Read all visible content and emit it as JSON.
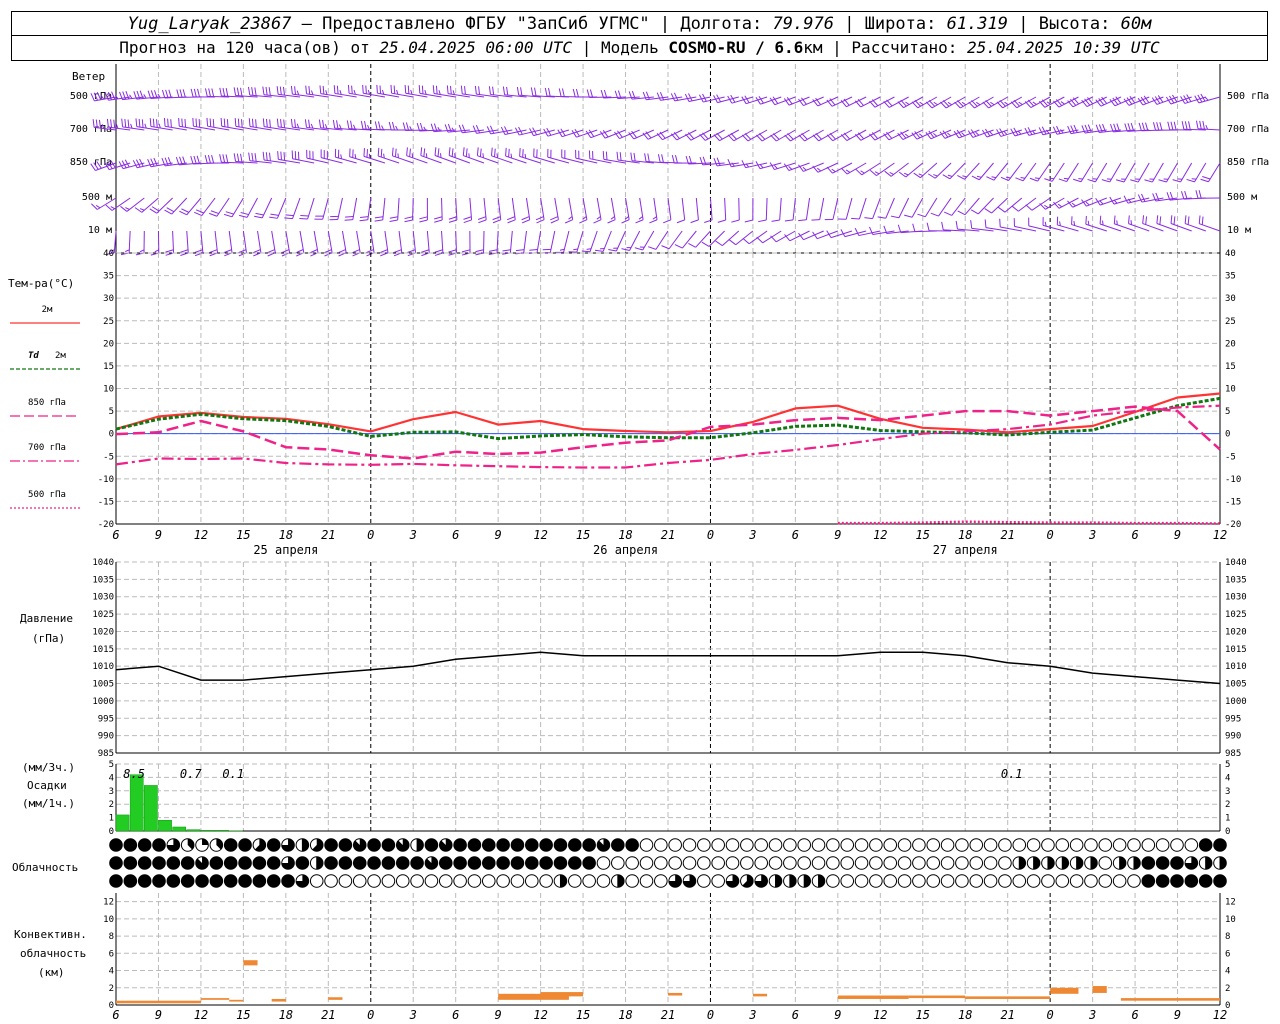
{
  "header": {
    "station": "Yug_Laryak_23867",
    "provider": "— Предоставлено ФГБУ \"ЗапСиб УГМС\"",
    "lon_label": "| Долгота:",
    "lon": "79.976",
    "lat_label": "| Широта:",
    "lat": "61.319",
    "alt_label": "| Высота:",
    "alt": "60м",
    "forecast_label": "Прогноз на 120 часа(ов) от",
    "forecast_time": "25.04.2025 06:00 UTC",
    "model_label": "| Модель",
    "model": "COSMO-RU / 6.6",
    "model_unit": "км",
    "calc_label": "| Рассчитано:",
    "calc_time": "25.04.2025 10:39 UTC"
  },
  "labels": {
    "wind": "Ветер",
    "wind_levels": [
      "500 гПа",
      "700 гПа",
      "850 гПа",
      "500 м",
      "10 м"
    ],
    "temp": "Тем-ра(°C)",
    "t2m": "2м",
    "td_sym": "Td",
    "td2m": "2м",
    "t850": "850 гПа",
    "t700": "700 гПа",
    "t500": "500 гПа",
    "pressure": "Давление",
    "pressure_unit": "(гПа)",
    "precip_unit3": "(мм/3ч.)",
    "precip": "Осадки",
    "precip_unit1": "(мм/1ч.)",
    "cloud": "Облачность",
    "conv1": "Конвективн.",
    "conv2": "облачность",
    "conv3": "(км)"
  },
  "time_axis": {
    "hour_labels": [
      "6",
      "9",
      "12",
      "15",
      "18",
      "21",
      "0",
      "3",
      "6",
      "9",
      "12",
      "15",
      "18",
      "21",
      "0",
      "3",
      "6",
      "9",
      "12",
      "15",
      "18",
      "21",
      "0",
      "3",
      "6",
      "9",
      "12"
    ],
    "day_labels": [
      "25 апреля",
      "26 апреля",
      "27 апреля"
    ]
  },
  "colors": {
    "t2m": "#ff3333",
    "td2m": "#117711",
    "t850": "#ee2288",
    "wind": "#8a2be2",
    "precip": "#22cc22",
    "conv": "#ee8833"
  },
  "chart_data": {
    "type": "line",
    "hours": [
      0,
      3,
      6,
      9,
      12,
      15,
      18,
      21,
      24,
      27,
      30,
      33,
      36,
      39,
      42,
      45,
      48,
      51,
      54,
      57,
      60,
      63,
      66,
      69,
      72,
      75,
      78
    ],
    "temperature": {
      "ylim": [
        -20,
        40
      ],
      "ticks": [
        -20,
        -15,
        -10,
        -5,
        0,
        5,
        10,
        15,
        20,
        25,
        30,
        35,
        40
      ],
      "series": [
        {
          "name": "2м",
          "values": [
            1,
            3.8,
            4.6,
            3.7,
            3.3,
            2.1,
            0.5,
            3.2,
            4.8,
            2.0,
            2.8,
            1.0,
            0.6,
            0.3,
            0.6,
            2.6,
            5.6,
            6.2,
            3.3,
            1.3,
            0.9,
            0.3,
            1.0,
            1.7,
            4.8,
            8.0,
            8.9
          ]
        },
        {
          "name": "Td 2м",
          "values": [
            1,
            3.2,
            4.3,
            3.3,
            2.9,
            1.6,
            -0.6,
            0.3,
            0.4,
            -1.1,
            -0.5,
            -0.2,
            -0.7,
            -0.9,
            -0.9,
            0.2,
            1.6,
            1.9,
            0.7,
            0.4,
            0.2,
            -0.3,
            0.3,
            0.8,
            3.5,
            6.2,
            7.8
          ]
        },
        {
          "name": "850 гПа",
          "values": [
            -0.1,
            0.3,
            2.8,
            0.5,
            -3,
            -3.5,
            -4.8,
            -5.5,
            -4,
            -4.5,
            -4.2,
            -3,
            -2,
            -1.5,
            1.5,
            2,
            3,
            3.5,
            3,
            4,
            5,
            5,
            4,
            5,
            6,
            5,
            -3.5
          ]
        },
        {
          "name": "700 гПа",
          "values": [
            -6.8,
            -5.5,
            -5.6,
            -5.5,
            -6.5,
            -6.8,
            -6.9,
            -6.7,
            -7,
            -7.2,
            -7.4,
            -7.5,
            -7.5,
            -6.5,
            -5.8,
            -4.5,
            -3.6,
            -2.5,
            -1.2,
            0,
            0.5,
            1,
            2,
            4,
            5,
            5.8,
            6.2
          ]
        },
        {
          "name": "500 гПа",
          "values": [
            null,
            null,
            null,
            null,
            null,
            null,
            null,
            null,
            null,
            null,
            null,
            null,
            null,
            null,
            null,
            null,
            null,
            -19.8,
            -19.8,
            -19.7,
            -19.5,
            -19.6,
            -19.7,
            -19.7,
            -19.8,
            -19.8,
            -19.9
          ]
        }
      ]
    },
    "pressure": {
      "ylim": [
        985,
        1040
      ],
      "ticks": [
        985,
        990,
        995,
        1000,
        1005,
        1010,
        1015,
        1020,
        1025,
        1030,
        1035,
        1040
      ],
      "values": [
        1009,
        1010,
        1006,
        1006,
        1007,
        1008,
        1009,
        1010,
        1012,
        1013,
        1014,
        1013,
        1013,
        1013,
        1013,
        1013,
        1013,
        1013,
        1014,
        1014,
        1013,
        1011,
        1010,
        1008,
        1007,
        1006,
        1005
      ]
    },
    "precipitation": {
      "ylim": [
        0,
        5
      ],
      "ticks": [
        0,
        1,
        2,
        3,
        4,
        5
      ],
      "hourly": [
        1.2,
        4.2,
        3.4,
        0.8,
        0.3,
        0.1,
        0.05,
        0.05,
        0.02
      ],
      "label_start_index": 0,
      "accum_labels": [
        {
          "hour": 1,
          "text": "8.5"
        },
        {
          "hour": 5,
          "text": "0.7"
        },
        {
          "hour": 8,
          "text": "0.1"
        },
        {
          "hour": 63,
          "text": "0.1"
        }
      ]
    },
    "convective": {
      "ylim": [
        0,
        13
      ],
      "ticks": [
        0,
        2,
        4,
        6,
        8,
        10,
        12
      ],
      "bars": [
        {
          "h0": 0,
          "h1": 6,
          "bot": 0.2,
          "top": 0.5
        },
        {
          "h0": 6,
          "h1": 8,
          "bot": 0.6,
          "top": 0.8
        },
        {
          "h0": 8,
          "h1": 9,
          "bot": 0.4,
          "top": 0.6
        },
        {
          "h0": 9,
          "h1": 10,
          "bot": 4.6,
          "top": 5.2
        },
        {
          "h0": 11,
          "h1": 12,
          "bot": 0.4,
          "top": 0.7
        },
        {
          "h0": 15,
          "h1": 16,
          "bot": 0.6,
          "top": 0.9
        },
        {
          "h0": 27,
          "h1": 32,
          "bot": 0.6,
          "top": 1.3
        },
        {
          "h0": 30,
          "h1": 33,
          "bot": 1.0,
          "top": 1.5
        },
        {
          "h0": 39,
          "h1": 40,
          "bot": 1.1,
          "top": 1.4
        },
        {
          "h0": 45,
          "h1": 46,
          "bot": 1.0,
          "top": 1.3
        },
        {
          "h0": 51,
          "h1": 56,
          "bot": 0.7,
          "top": 1.1
        },
        {
          "h0": 56,
          "h1": 60,
          "bot": 0.8,
          "top": 1.1
        },
        {
          "h0": 60,
          "h1": 66,
          "bot": 0.7,
          "top": 1.0
        },
        {
          "h0": 66,
          "h1": 68,
          "bot": 1.3,
          "top": 2.0
        },
        {
          "h0": 69,
          "h1": 70,
          "bot": 1.4,
          "top": 2.2
        },
        {
          "h0": 71,
          "h1": 78,
          "bot": 0.5,
          "top": 0.8
        }
      ]
    },
    "cloud_cover": {
      "levels": 3,
      "comment_free_rows": [
        [
          8,
          8,
          8,
          8,
          6,
          3,
          2,
          3,
          8,
          8,
          5,
          8,
          6,
          4,
          5,
          8,
          8,
          7,
          8,
          8,
          7,
          4,
          8,
          7,
          8,
          8,
          8,
          8,
          8,
          8,
          8,
          8,
          8,
          8,
          7,
          8,
          8,
          0,
          0,
          0,
          0,
          0,
          0,
          0,
          0,
          0,
          0,
          0,
          0,
          0,
          0,
          0,
          0,
          0,
          0,
          0,
          0,
          0,
          0,
          0,
          0,
          0,
          0,
          0,
          0,
          0,
          0,
          0,
          0,
          0,
          0,
          0,
          0,
          0,
          0,
          0,
          8,
          8
        ],
        [
          8,
          8,
          8,
          8,
          8,
          8,
          7,
          8,
          8,
          8,
          8,
          8,
          6,
          8,
          4,
          8,
          8,
          8,
          8,
          8,
          8,
          8,
          7,
          8,
          8,
          8,
          8,
          8,
          8,
          8,
          8,
          8,
          8,
          8,
          0,
          0,
          0,
          0,
          0,
          0,
          0,
          0,
          0,
          0,
          0,
          0,
          0,
          0,
          0,
          0,
          0,
          0,
          0,
          0,
          0,
          0,
          0,
          0,
          0,
          0,
          0,
          0,
          0,
          4,
          4,
          4,
          4,
          4,
          4,
          0,
          4,
          4,
          8,
          8,
          8,
          6,
          4,
          4
        ],
        [
          8,
          8,
          8,
          8,
          8,
          8,
          8,
          8,
          8,
          8,
          8,
          8,
          8,
          6,
          0,
          0,
          0,
          0,
          0,
          0,
          0,
          0,
          0,
          0,
          0,
          0,
          0,
          0,
          0,
          0,
          0,
          4,
          0,
          0,
          0,
          4,
          0,
          0,
          0,
          6,
          6,
          0,
          0,
          6,
          5,
          6,
          4,
          4,
          4,
          4,
          0,
          0,
          0,
          0,
          0,
          0,
          0,
          0,
          0,
          0,
          0,
          0,
          0,
          0,
          0,
          0,
          0,
          0,
          0,
          0,
          0,
          0,
          8,
          8,
          8,
          8,
          8,
          8
        ]
      ]
    },
    "wind_barbs": {
      "levels": [
        "500 гПа",
        "700 гПа",
        "850 гПа",
        "500 м",
        "10 м"
      ]
    }
  }
}
